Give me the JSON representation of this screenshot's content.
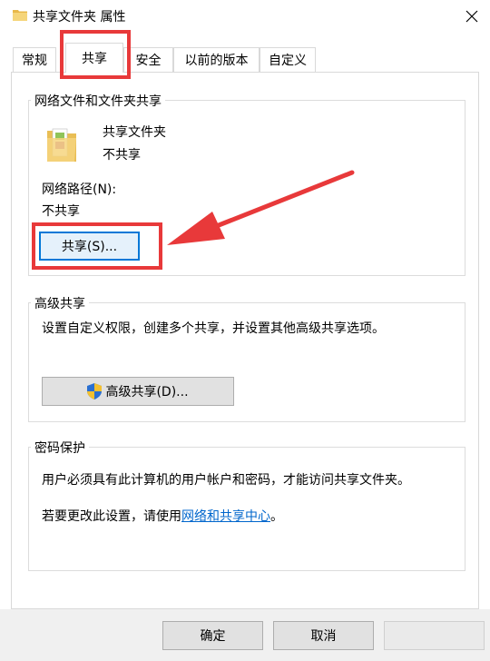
{
  "window": {
    "title": "共享文件夹 属性",
    "icon": "folder-icon"
  },
  "tabs": [
    {
      "label": "常规"
    },
    {
      "label": "共享"
    },
    {
      "label": "安全"
    },
    {
      "label": "以前的版本"
    },
    {
      "label": "自定义"
    }
  ],
  "network_sharing": {
    "group_title": "网络文件和文件夹共享",
    "folder_name": "共享文件夹",
    "folder_status": "不共享",
    "path_label": "网络路径(N):",
    "path_value": "不共享",
    "share_button": "共享(S)..."
  },
  "advanced_sharing": {
    "group_title": "高级共享",
    "description": "设置自定义权限，创建多个共享，并设置其他高级共享选项。",
    "button": "高级共享(D)..."
  },
  "password_protection": {
    "group_title": "密码保护",
    "description": "用户必须具有此计算机的用户帐户和密码，才能访问共享文件夹。",
    "change_text": "若要更改此设置，请使用",
    "link_text": "网络和共享中心",
    "change_suffix": "。"
  },
  "footer": {
    "ok": "确定",
    "cancel": "取消",
    "apply": ""
  },
  "colors": {
    "highlight": "#e8393a",
    "link": "#0066cc",
    "focus": "#0078d7"
  }
}
